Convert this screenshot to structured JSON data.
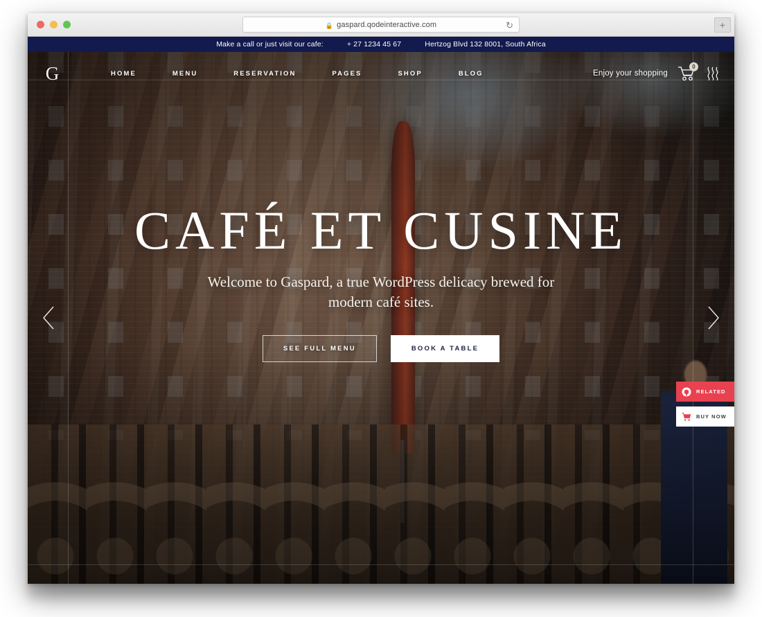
{
  "browser": {
    "url": "gaspard.qodeinteractive.com",
    "lock_icon": "lock-icon",
    "reload_icon": "reload-icon",
    "new_tab_label": "+",
    "traffic_lights": [
      "close-red",
      "minimize-yellow",
      "maximize-green"
    ]
  },
  "top_bar": {
    "background": "#131a4e",
    "tagline": "Make a call or just visit our cafe:",
    "phone": "+ 27 1234 45 67",
    "address": "Hertzog Blvd 132 8001, South Africa"
  },
  "nav": {
    "logo": "G",
    "items": [
      {
        "label": "HOME"
      },
      {
        "label": "MENU"
      },
      {
        "label": "RESERVATION"
      },
      {
        "label": "PAGES"
      },
      {
        "label": "SHOP"
      },
      {
        "label": "BLOG"
      }
    ],
    "shopping_text": "Enjoy your shopping",
    "cart_icon": "shopping-cart-icon",
    "cart_count": "0",
    "menu_icon": "steam-lines-menu-icon"
  },
  "hero": {
    "title": "CAFÉ ET CUSINE",
    "subtitle": "Welcome to Gaspard, a true WordPress delicacy brewed for modern café sites.",
    "buttons": [
      {
        "label": "SEE FULL MENU",
        "style": "outline"
      },
      {
        "label": "BOOK A TABLE",
        "style": "solid"
      }
    ],
    "prev_icon": "chevron-left-icon",
    "next_icon": "chevron-right-icon"
  },
  "floating_widgets": [
    {
      "label": "RELATED",
      "icon": "circle-target-icon",
      "accent": "#e8414f",
      "text_color": "#ffffff"
    },
    {
      "label": "BUY NOW",
      "icon": "cart-icon",
      "accent": "#ffffff",
      "text_color": "#3c3c3c"
    }
  ],
  "colors": {
    "navy": "#131a4e",
    "accent_red": "#e8414f",
    "white": "#ffffff"
  }
}
